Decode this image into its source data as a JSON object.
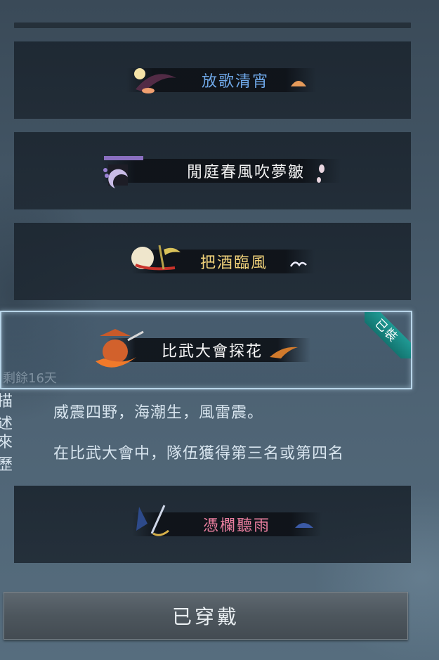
{
  "titles": [
    {
      "name": "放歌清宵",
      "color": "#6fa8e8"
    },
    {
      "name": "閒庭春風吹夢皺",
      "color": "#f2f2f2"
    },
    {
      "name": "把酒臨風",
      "color": "#f1d27a"
    },
    {
      "name": "比武大會探花",
      "color": "#f6f6f6",
      "equipped_tag": "已裝",
      "remaining": "剩餘16天"
    },
    {
      "name": "憑欄聽雨",
      "color": "#ec7fa0"
    }
  ],
  "details": {
    "description_label": "描述",
    "description_value": "威震四野，海潮生，風雷震。",
    "history_label": "來歷",
    "history_value": "在比武大會中，隊伍獲得第三名或第四名"
  },
  "action_button": "已穿戴",
  "colors": {
    "equipped_tag": "#1a8d88",
    "selected_border": "#b9d6ea"
  }
}
